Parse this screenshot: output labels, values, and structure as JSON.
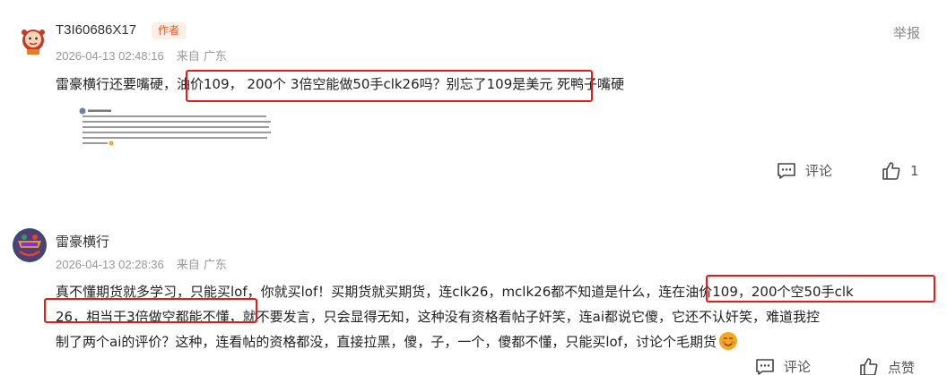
{
  "comments": [
    {
      "username": "T3I60686X17",
      "badge": "作者",
      "timestamp": "2026-04-13 02:48:16",
      "location": "来自 广东",
      "report_label": "举报",
      "text_pre": "雷豪横行还要嘴硬，",
      "text_highlight": "油价109， 200个 3倍空能做50手clk26吗？别忘了109是美元",
      "text_post": " 死鸭子嘴硬",
      "reply_label": "评论",
      "like_count": "1"
    },
    {
      "username": "雷豪横行",
      "timestamp": "2026-04-13 02:28:36",
      "location": "来自 广东",
      "line1_pre": "真不懂期货就多学习，只能买lof，你就买lof！买期货就买期货，连clk26，mclk26都不知道是什么，",
      "line1_hl": "连在油价109，200个空50手clk",
      "line2_hl": "26，相当于3倍做空都能不懂，",
      "line2_post": "就不要发言，只会显得无知，这种没有资格看帖子奸笑，连ai都说它傻，它还不认奸笑，难道我控",
      "line3": "制了两个ai的评价？这种，连看帖的资格都没，直接拉黑，傻，子，一个，傻都不懂，只能买lof，讨论个毛期货",
      "reply_label": "评论",
      "like_label": "点赞"
    }
  ],
  "icons": {
    "reply": "comment-icon",
    "like": "thumbs-up-icon",
    "emoji": "smirk-emoji-icon"
  },
  "colors": {
    "highlight_border": "#e41b1b",
    "author_badge_text": "#f05a24",
    "author_badge_bg": "#fdeee6",
    "meta_text": "#999999"
  }
}
